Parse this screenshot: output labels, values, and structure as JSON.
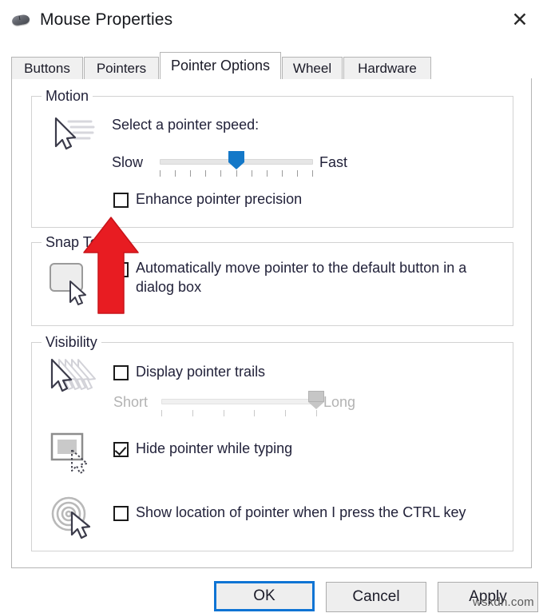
{
  "window": {
    "title": "Mouse Properties",
    "icon": "mouse-icon",
    "close_label": "✕"
  },
  "tabs": [
    {
      "label": "Buttons",
      "active": false
    },
    {
      "label": "Pointers",
      "active": false
    },
    {
      "label": "Pointer Options",
      "active": true
    },
    {
      "label": "Wheel",
      "active": false
    },
    {
      "label": "Hardware",
      "active": false
    }
  ],
  "motion": {
    "group_label": "Motion",
    "icon": "pointer-speed-icon",
    "heading": "Select a pointer speed:",
    "slider": {
      "min_label": "Slow",
      "max_label": "Fast",
      "value": 6,
      "min": 1,
      "max": 11,
      "tick_count": 11,
      "thumb_color": "#1478c8",
      "enabled": true
    },
    "enhance_precision": {
      "label": "Enhance pointer precision",
      "checked": false
    }
  },
  "snap_to": {
    "group_label": "Snap To",
    "icon": "default-button-icon",
    "option": {
      "label_line1": "Automatically move pointer to the default button in a",
      "label_line2": "dialog box",
      "checked": false
    }
  },
  "visibility": {
    "group_label": "Visibility",
    "trails": {
      "icon": "pointer-trails-icon",
      "label": "Display pointer trails",
      "checked": false,
      "slider": {
        "min_label": "Short",
        "max_label": "Long",
        "value": 6,
        "min": 1,
        "max": 6,
        "tick_count": 6,
        "thumb_color": "#c6c6c6",
        "enabled": false
      }
    },
    "hide_while_typing": {
      "icon": "hide-pointer-icon",
      "label": "Hide pointer while typing",
      "checked": true
    },
    "show_location": {
      "icon": "show-location-icon",
      "label": "Show location of pointer when I press the CTRL key",
      "checked": false
    }
  },
  "buttons": {
    "ok": "OK",
    "cancel": "Cancel",
    "apply": "Apply"
  },
  "annotation": {
    "type": "red-arrow-up",
    "color": "#E81C22",
    "points_at": "Enhance pointer precision"
  },
  "watermark": {
    "text": "wsxdn.com"
  }
}
